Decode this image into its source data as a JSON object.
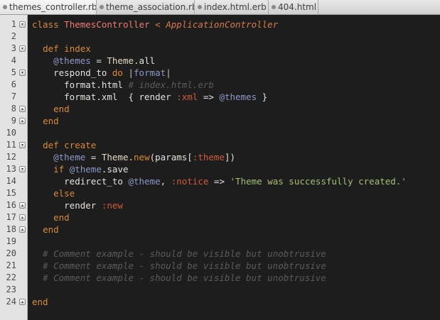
{
  "tabs": [
    {
      "label": "themes_controller.rb",
      "active": true
    },
    {
      "label": "theme_association.rb",
      "active": false
    },
    {
      "label": "index.html.erb",
      "active": false
    },
    {
      "label": "404.html",
      "active": false
    }
  ],
  "gutter": {
    "line_numbers": [
      "1",
      "2",
      "3",
      "4",
      "5",
      "6",
      "7",
      "8",
      "9",
      "10",
      "11",
      "12",
      "13",
      "14",
      "15",
      "16",
      "17",
      "18",
      "19",
      "20",
      "21",
      "22",
      "23",
      "24"
    ],
    "fold_markers": {
      "1": "open",
      "3": "open",
      "5": "open",
      "8": "close",
      "9": "close",
      "11": "open",
      "13": "open",
      "16": "close",
      "17": "close",
      "18": "close",
      "24": "close"
    }
  },
  "code": {
    "lines": [
      "class ThemesController < ApplicationController",
      "",
      "  def index",
      "    @themes = Theme.all",
      "    respond_to do |format|",
      "      format.html # index.html.erb",
      "      format.xml  { render :xml => @themes }",
      "    end",
      "  end",
      "",
      "  def create",
      "    @theme = Theme.new(params[:theme])",
      "    if @theme.save",
      "      redirect_to @theme, :notice => 'Theme was successfully created.'",
      "    else",
      "      render :new",
      "    end",
      "  end",
      "",
      "  # Comment example - should be visible but unobtrusive",
      "  # Comment example - should be visible but unobtrusive",
      "  # Comment example - should be visible but unobtrusive",
      "",
      "end"
    ]
  },
  "colors": {
    "background": "#1d1d1d",
    "keyword": "#d88a3a",
    "class_name": "#f07a72",
    "instance_var": "#8b98c8",
    "symbol": "#d05a3a",
    "string": "#a6bf76",
    "comment": "#5b5b5b"
  }
}
